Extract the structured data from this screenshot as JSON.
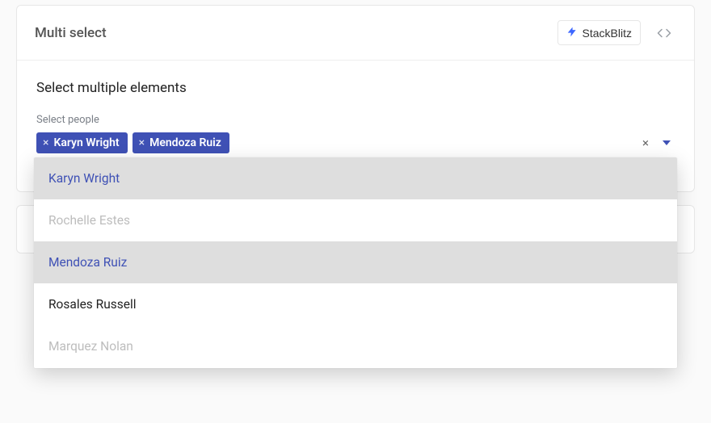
{
  "card": {
    "title": "Multi select",
    "stackblitzLabel": "StackBlitz"
  },
  "section": {
    "heading": "Select multiple elements",
    "fieldLabel": "Select people"
  },
  "selected": [
    {
      "name": "Karyn Wright"
    },
    {
      "name": "Mendoza Ruiz"
    }
  ],
  "options": [
    {
      "name": "Karyn Wright",
      "state": "selected"
    },
    {
      "name": "Rochelle Estes",
      "state": "disabled"
    },
    {
      "name": "Mendoza Ruiz",
      "state": "selected"
    },
    {
      "name": "Rosales Russell",
      "state": "normal"
    },
    {
      "name": "Marquez Nolan",
      "state": "disabled"
    }
  ]
}
